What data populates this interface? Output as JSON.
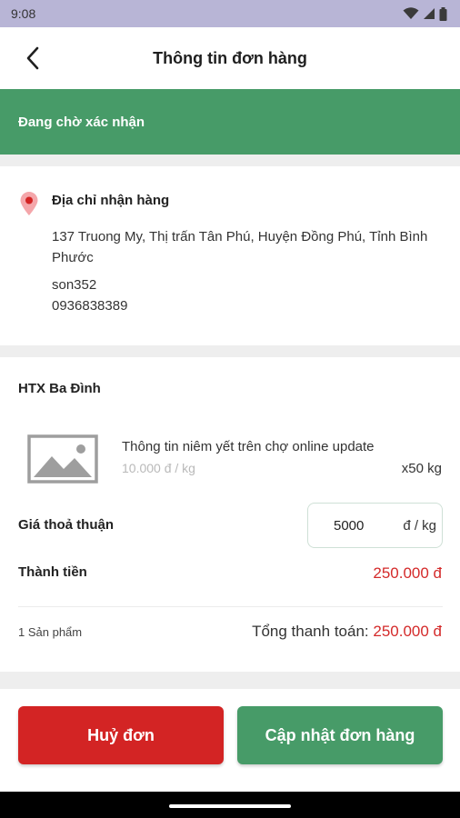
{
  "status_bar": {
    "time": "9:08",
    "icons": [
      "wifi-icon",
      "cellular-signal-icon",
      "battery-icon"
    ]
  },
  "app_bar": {
    "title": "Thông tin đơn hàng",
    "back_icon": "back-arrow-icon"
  },
  "order_status": {
    "label": "Đang chờ xác nhận",
    "color": "#479b68"
  },
  "address": {
    "icon": "location-pin-icon",
    "heading": "Địa chỉ nhận hàng",
    "text": "137 Truong My, Thị trấn Tân Phú, Huyện Đồng Phú, Tỉnh Bình Phước",
    "name": "son352",
    "phone": "0936838389"
  },
  "order": {
    "shop_name": "HTX Ba Đình",
    "product": {
      "image_icon": "image-placeholder-icon",
      "name": "Thông tin niêm yết trên chợ online update",
      "listed_price": "10.000 đ / kg",
      "quantity": "x50 kg"
    },
    "agreed_price_label": "Giá thoả thuận",
    "agreed_price_value": "5000",
    "agreed_price_unit": "đ / kg",
    "subtotal_label": "Thành tiền",
    "subtotal_value": "250.000 đ",
    "item_count": "1 Sản phẩm",
    "grand_total_label": "Tổng thanh toán:",
    "grand_total_value": "250.000 đ"
  },
  "actions": {
    "cancel_label": "Huỷ đơn",
    "update_label": "Cập nhật đơn hàng"
  },
  "colors": {
    "primary_green": "#479b68",
    "danger_red": "#d32424",
    "status_bar": "#b8b5d6"
  }
}
